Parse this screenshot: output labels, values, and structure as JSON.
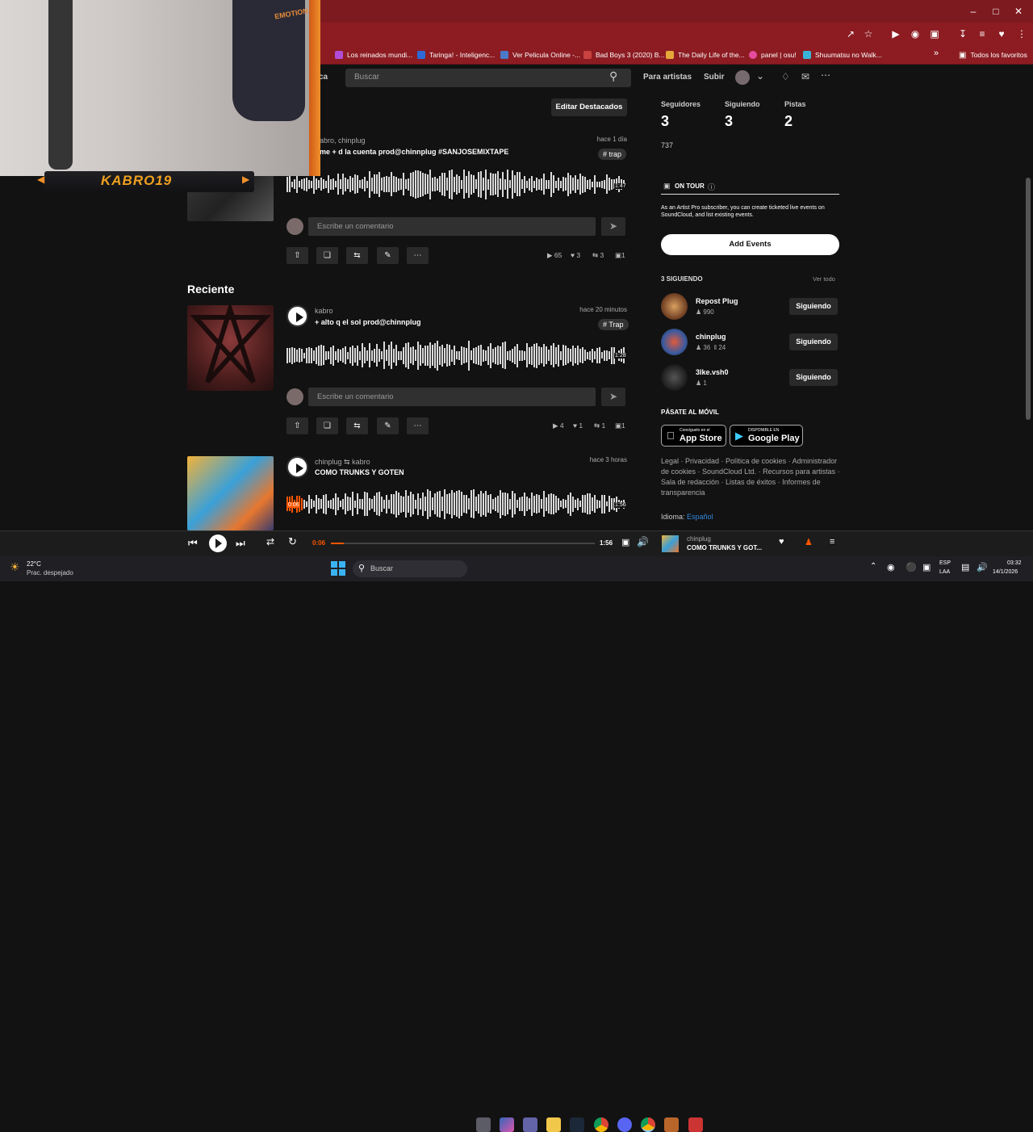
{
  "browser": {
    "bookmarks": [
      {
        "label": "Los reinados mundi...",
        "color": "#b04dd8"
      },
      {
        "label": "Taringa! - Inteligenc...",
        "color": "#2d6ad6"
      },
      {
        "label": "Ver Pelicula Online -...",
        "color": "#4a79c9"
      },
      {
        "label": "Bad Boys 3 (2020) B...",
        "color": "#c9423f"
      },
      {
        "label": "The Daily Life of the...",
        "color": "#e5a83a"
      },
      {
        "label": "panel | osu!",
        "color": "#e64b9e"
      },
      {
        "label": "Shuumatsu no Walk...",
        "color": "#3ab3d8"
      }
    ],
    "other_bookmarks": "Todos los favoritos"
  },
  "header": {
    "library_partial": "ca",
    "search_placeholder": "Buscar",
    "for_artists": "Para artistas",
    "upload": "Subir"
  },
  "webcam": {
    "streamer_name": "KABRO19",
    "shirt_text": "EMOTION"
  },
  "spotlight": {
    "edit_button": "Editar Destacados",
    "track": {
      "user": "abro, chinplug",
      "title": "me + d la cuenta prod@chinnplug #SANJOSEMIXTAPE",
      "time": "hace 1 día",
      "tag": "# trap",
      "duration": "1:47",
      "comment_placeholder": "Escribe un comentario",
      "plays": "65",
      "likes": "3",
      "reposts": "3",
      "comments": "1"
    }
  },
  "recent": {
    "heading": "Reciente",
    "tracks": [
      {
        "user": "kabro",
        "title": "+ alto q el sol prod@chinnplug",
        "time": "hace 20 minutos",
        "tag": "# Trap",
        "duration": "1:28",
        "comment_placeholder": "Escribe un comentario",
        "plays": "4",
        "likes": "1",
        "reposts": "1",
        "comments": "1"
      },
      {
        "user": "chinplug",
        "repost_by": "kabro",
        "title": "COMO TRUNKS Y GOTEN",
        "time": "hace 3 horas",
        "elapsed": "0:06",
        "duration": "1:56",
        "progress": 0.05
      }
    ]
  },
  "sidebar": {
    "stats": [
      {
        "label": "Seguidores",
        "value": "3"
      },
      {
        "label": "Siguiendo",
        "value": "3"
      },
      {
        "label": "Pistas",
        "value": "2"
      }
    ],
    "bio": "737",
    "on_tour_label": "ON TOUR",
    "on_tour_text": "As an Artist Pro subscriber, you can create ticketed live events on SoundCloud, and list existing events.",
    "add_events": "Add Events",
    "following_heading": "3 SIGUIENDO",
    "view_all": "Ver todo",
    "following": [
      {
        "name": "Repost Plug",
        "followers": "990",
        "tracks": "",
        "button": "Siguiendo"
      },
      {
        "name": "chinplug",
        "followers": "36",
        "tracks": "24",
        "button": "Siguiendo"
      },
      {
        "name": "3lke.vsh0",
        "followers": "1",
        "tracks": "",
        "button": "Siguiendo"
      }
    ],
    "mobile_heading": "PÁSATE AL MÓVIL",
    "app_store_small": "Consíguelo en el",
    "app_store": "App Store",
    "google_small": "DISPONIBLE EN",
    "google_play": "Google Play",
    "footer": "Legal · Privacidad · Política de cookies · Administrador de cookies · SoundCloud Ltd. · Recursos para artistas · Sala de redacción · Listas de éxitos · Informes de transparencia",
    "language_label": "Idioma:",
    "language_value": "Español"
  },
  "player": {
    "elapsed": "0:06",
    "duration": "1:56",
    "progress": 0.05,
    "track_user": "chinplug",
    "track_title": "COMO TRUNKS Y GOT..."
  },
  "taskbar": {
    "temp": "22°C",
    "weather": "Prac. despejado",
    "search": "Buscar",
    "lang1": "ESP",
    "lang2": "LAA",
    "time": "03:32",
    "date": "14/1/2026"
  },
  "colors": {
    "accent": "#ff5500",
    "chrome": "#8c1c22",
    "background": "#121212"
  }
}
